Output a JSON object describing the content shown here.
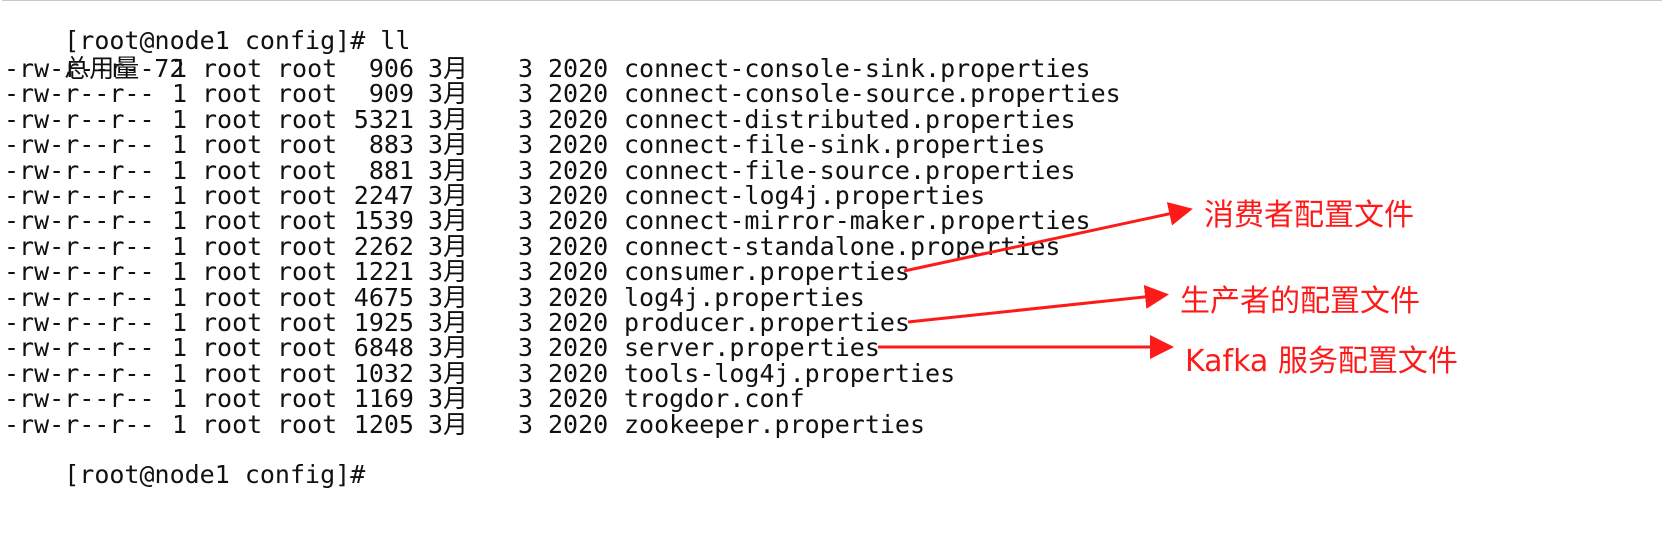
{
  "terminal": {
    "prompt_start": "[root@node1 config]# ll",
    "total_line": "总用量 72",
    "prompt_end": "[root@node1 config]#",
    "files": [
      {
        "perm": "-rw-r--r--",
        "links": "1",
        "owner": "root",
        "group": "root",
        "size": "906",
        "month": "3月",
        "day": "3",
        "year": "2020",
        "name": "connect-console-sink.properties"
      },
      {
        "perm": "-rw-r--r--",
        "links": "1",
        "owner": "root",
        "group": "root",
        "size": "909",
        "month": "3月",
        "day": "3",
        "year": "2020",
        "name": "connect-console-source.properties"
      },
      {
        "perm": "-rw-r--r--",
        "links": "1",
        "owner": "root",
        "group": "root",
        "size": "5321",
        "month": "3月",
        "day": "3",
        "year": "2020",
        "name": "connect-distributed.properties"
      },
      {
        "perm": "-rw-r--r--",
        "links": "1",
        "owner": "root",
        "group": "root",
        "size": "883",
        "month": "3月",
        "day": "3",
        "year": "2020",
        "name": "connect-file-sink.properties"
      },
      {
        "perm": "-rw-r--r--",
        "links": "1",
        "owner": "root",
        "group": "root",
        "size": "881",
        "month": "3月",
        "day": "3",
        "year": "2020",
        "name": "connect-file-source.properties"
      },
      {
        "perm": "-rw-r--r--",
        "links": "1",
        "owner": "root",
        "group": "root",
        "size": "2247",
        "month": "3月",
        "day": "3",
        "year": "2020",
        "name": "connect-log4j.properties"
      },
      {
        "perm": "-rw-r--r--",
        "links": "1",
        "owner": "root",
        "group": "root",
        "size": "1539",
        "month": "3月",
        "day": "3",
        "year": "2020",
        "name": "connect-mirror-maker.properties"
      },
      {
        "perm": "-rw-r--r--",
        "links": "1",
        "owner": "root",
        "group": "root",
        "size": "2262",
        "month": "3月",
        "day": "3",
        "year": "2020",
        "name": "connect-standalone.properties"
      },
      {
        "perm": "-rw-r--r--",
        "links": "1",
        "owner": "root",
        "group": "root",
        "size": "1221",
        "month": "3月",
        "day": "3",
        "year": "2020",
        "name": "consumer.properties"
      },
      {
        "perm": "-rw-r--r--",
        "links": "1",
        "owner": "root",
        "group": "root",
        "size": "4675",
        "month": "3月",
        "day": "3",
        "year": "2020",
        "name": "log4j.properties"
      },
      {
        "perm": "-rw-r--r--",
        "links": "1",
        "owner": "root",
        "group": "root",
        "size": "1925",
        "month": "3月",
        "day": "3",
        "year": "2020",
        "name": "producer.properties"
      },
      {
        "perm": "-rw-r--r--",
        "links": "1",
        "owner": "root",
        "group": "root",
        "size": "6848",
        "month": "3月",
        "day": "3",
        "year": "2020",
        "name": "server.properties"
      },
      {
        "perm": "-rw-r--r--",
        "links": "1",
        "owner": "root",
        "group": "root",
        "size": "1032",
        "month": "3月",
        "day": "3",
        "year": "2020",
        "name": "tools-log4j.properties"
      },
      {
        "perm": "-rw-r--r--",
        "links": "1",
        "owner": "root",
        "group": "root",
        "size": "1169",
        "month": "3月",
        "day": "3",
        "year": "2020",
        "name": "trogdor.conf"
      },
      {
        "perm": "-rw-r--r--",
        "links": "1",
        "owner": "root",
        "group": "root",
        "size": "1205",
        "month": "3月",
        "day": "3",
        "year": "2020",
        "name": "zookeeper.properties"
      }
    ]
  },
  "annotations": {
    "color": "#ff1a1a",
    "consumer_note": "消费者配置文件",
    "producer_note": "生产者的配置文件",
    "server_note": "Kafka 服务配置文件"
  }
}
